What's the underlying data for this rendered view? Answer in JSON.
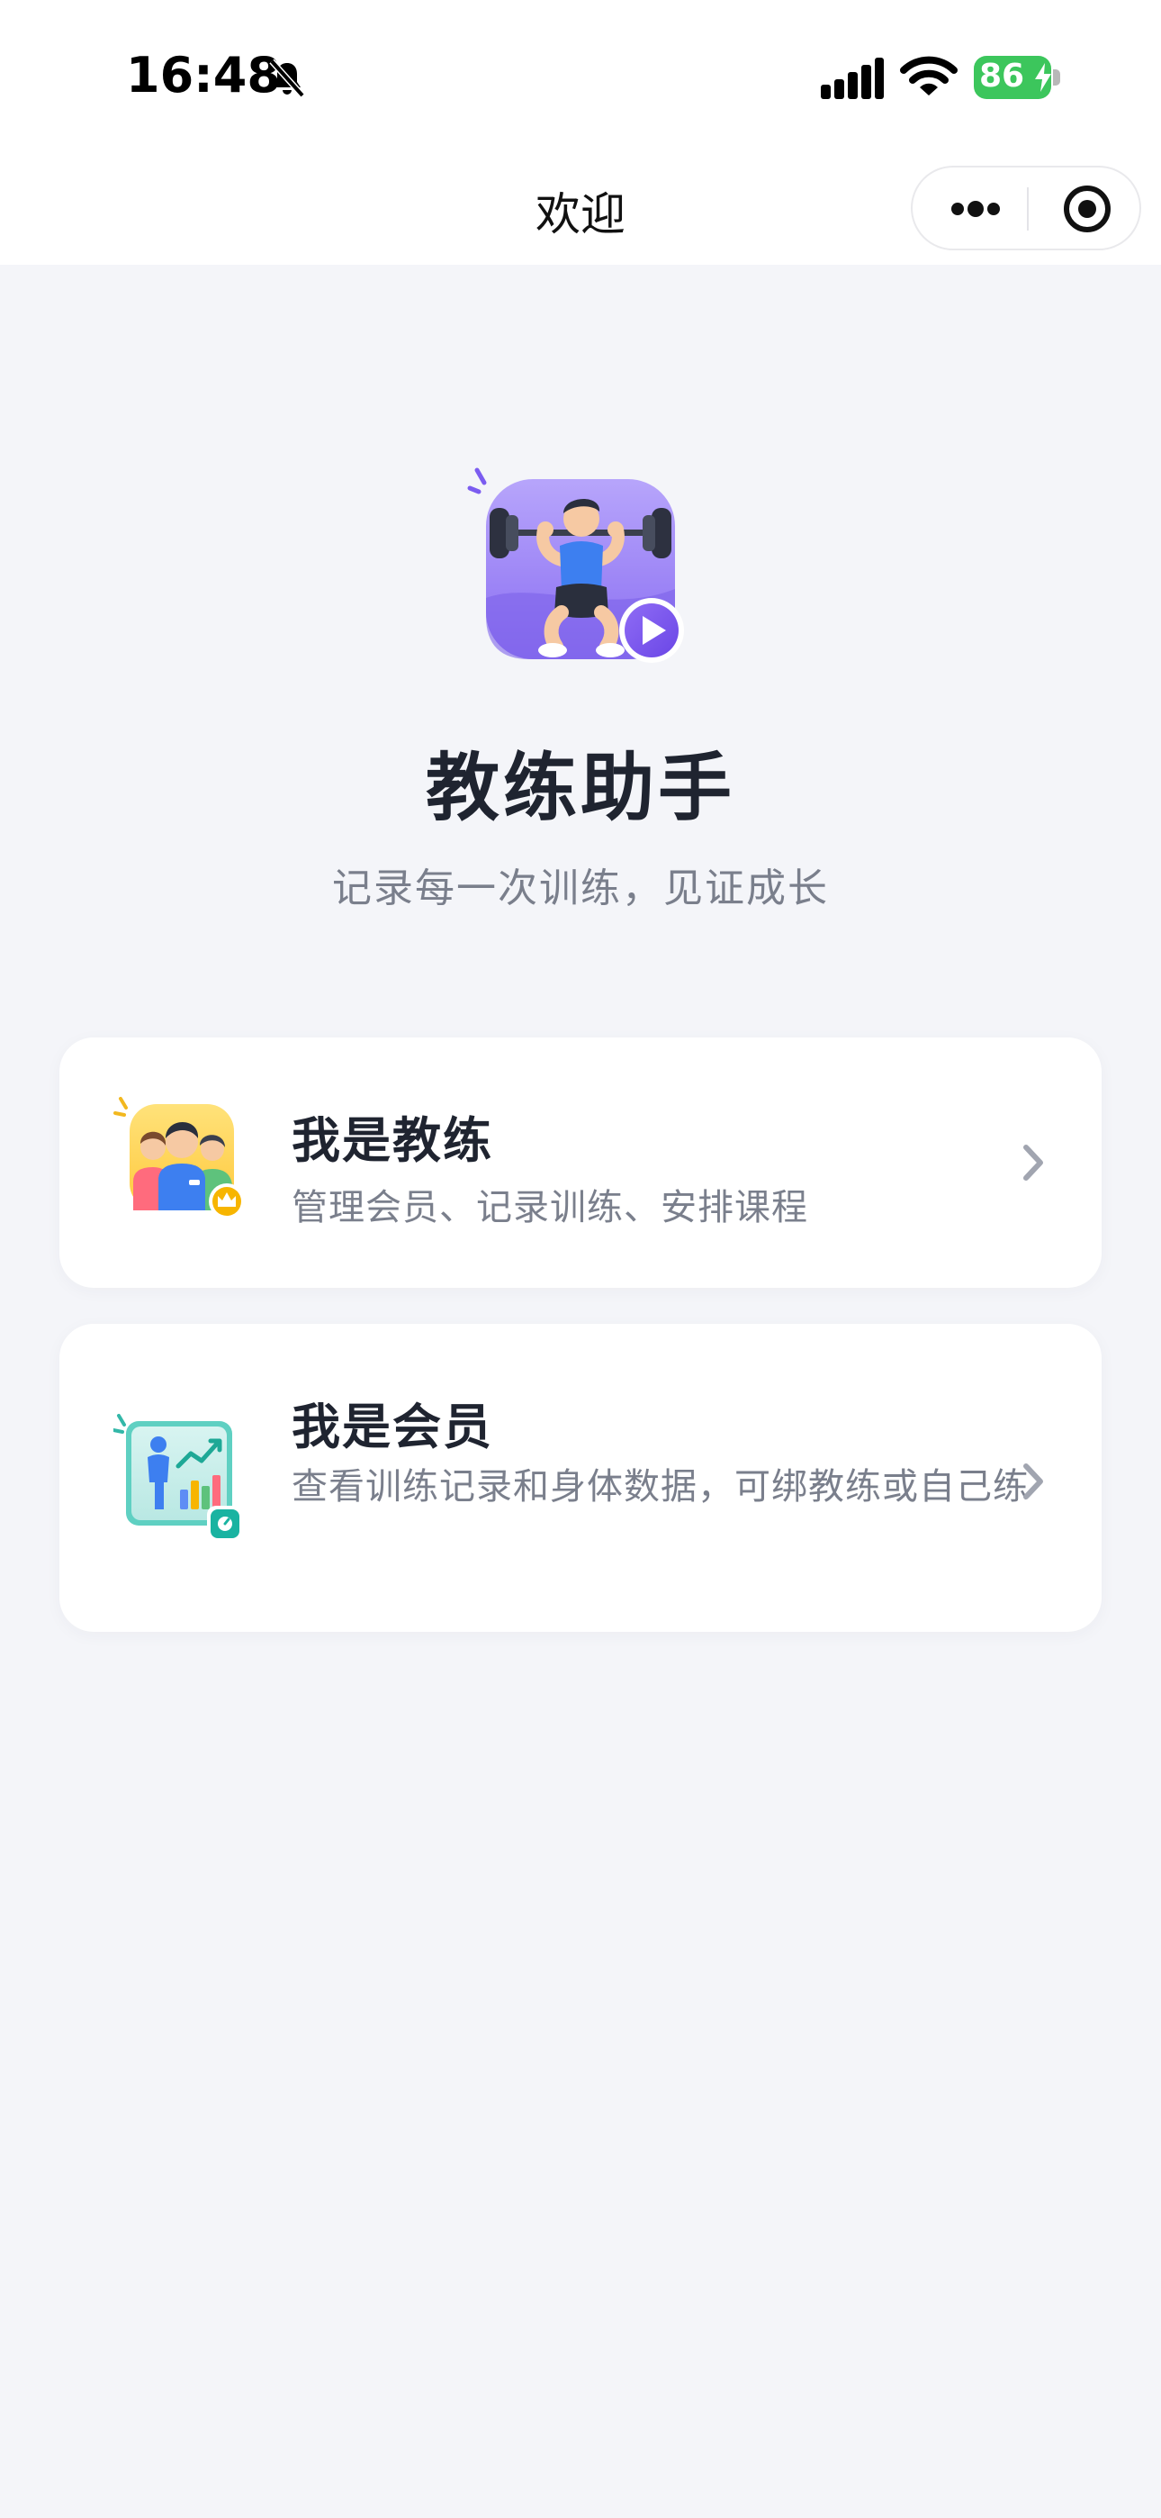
{
  "status_bar": {
    "time": "16:48",
    "battery": "86",
    "icons": [
      "bell-off-icon",
      "signal-icon",
      "wifi-icon",
      "battery-icon"
    ]
  },
  "nav": {
    "title": "欢迎",
    "icons": [
      "more-icon",
      "target-icon"
    ]
  },
  "hero": {
    "title": "教练助手",
    "subtitle": "记录每一次训练，见证成长",
    "logo_icon": "weightlifter-app-icon"
  },
  "roles": [
    {
      "title": "我是教练",
      "desc": "管理会员、记录训练、安排课程",
      "icon": "coach-group-icon"
    },
    {
      "title": "我是会员",
      "desc": "查看训练记录和身体数据，可绑教练或自己练",
      "icon": "member-stats-icon"
    }
  ],
  "colors": {
    "background": "#f4f5f9",
    "accent_purple": "#7b5cf0",
    "battery_green": "#3cc65c"
  }
}
